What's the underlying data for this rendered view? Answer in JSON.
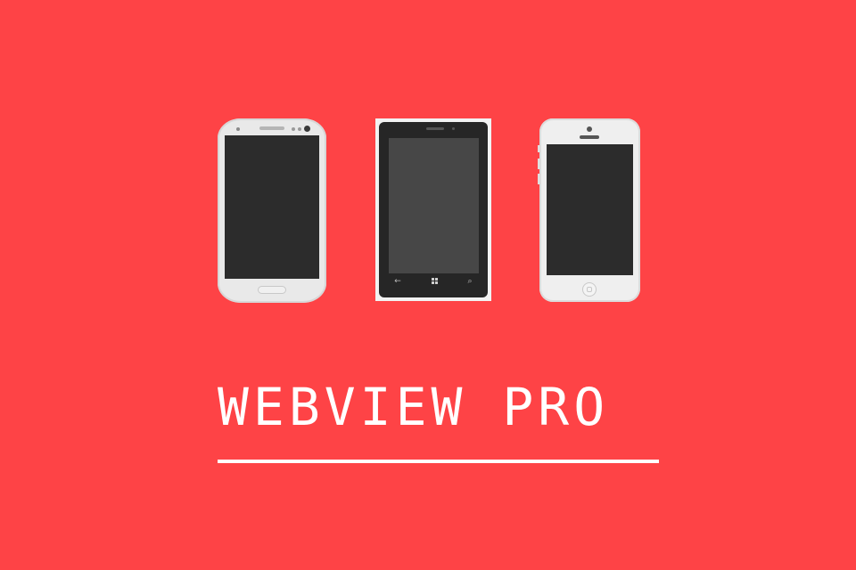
{
  "title": "WEBVIEW PRO",
  "colors": {
    "background": "#fe4346",
    "text": "#ffffff",
    "phone_white": "#efefef",
    "phone_dark": "#262626",
    "screen_dark": "#2c2c2c"
  },
  "devices": [
    {
      "kind": "android-phone-icon"
    },
    {
      "kind": "windows-phone-icon",
      "nav_icons": [
        "back-arrow-icon",
        "windows-logo-icon",
        "search-icon"
      ]
    },
    {
      "kind": "iphone-icon"
    }
  ],
  "winphone_nav": {
    "back": "←",
    "search": "⌕"
  }
}
